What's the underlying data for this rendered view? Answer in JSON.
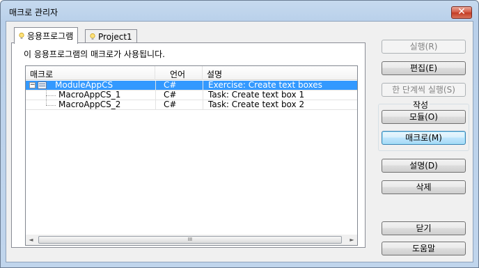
{
  "window": {
    "title": "매크로 관리자",
    "close_glyph": "✕"
  },
  "tabs": [
    {
      "label": "응용프로그램",
      "icon": "lightbulb-icon"
    },
    {
      "label": "Project1",
      "icon": "lightbulb-icon"
    }
  ],
  "panel": {
    "description": "이 응용프로그램의 매크로가 사용됩니다."
  },
  "list": {
    "columns": [
      "매크로",
      "언어",
      "설명"
    ],
    "rows": [
      {
        "name": "ModuleAppCS",
        "lang": "C#",
        "desc": "Exercise: Create text boxes",
        "selected": true,
        "expander": "−"
      },
      {
        "name": "MacroAppCS_1",
        "lang": "C#",
        "desc": "Task: Create text box 1"
      },
      {
        "name": "MacroAppCS_2",
        "lang": "C#",
        "desc": "Task: Create text box 2"
      }
    ],
    "scroll_left": "◄",
    "scroll_right": "►",
    "thumb_grip": "III"
  },
  "buttons": {
    "run": "실행(R)",
    "edit": "편집(E)",
    "step": "한 단계씩 실행(S)",
    "create_group": "작성",
    "module": "모듈(O)",
    "macro": "매크로(M)",
    "describe": "설명(D)",
    "delete": "삭제",
    "close": "닫기",
    "help": "도움말"
  },
  "colors": {
    "selection": "#3399ff",
    "accent_border": "#3c7fb1"
  }
}
